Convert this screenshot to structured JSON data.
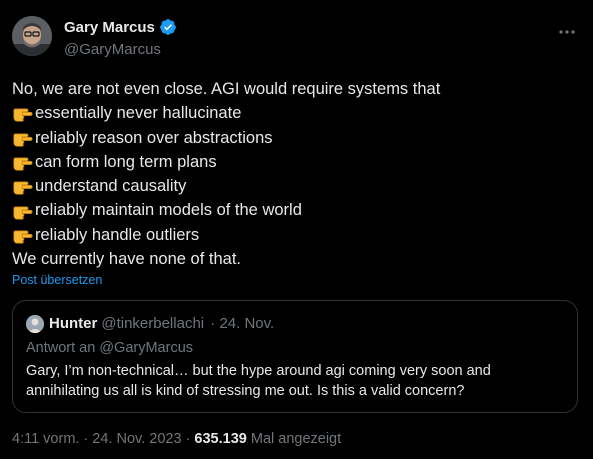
{
  "author": {
    "name": "Gary Marcus",
    "handle": "@GaryMarcus",
    "verified_color": "#1d9bf0"
  },
  "more_icon": "more-horizontal-icon",
  "tweet": {
    "intro": "No, we are not even close. AGI would require systems that",
    "bullet_icon": "pointing-hand-emoji",
    "bullets": [
      "essentially never hallucinate",
      "reliably reason over abstractions",
      "can form long term plans",
      "understand causality",
      "reliably maintain models of the world",
      "reliably handle outliers"
    ],
    "outro": "We currently have none of that."
  },
  "translate_label": "Post übersetzen",
  "quote": {
    "name": "Hunter",
    "handle": "@tinkerbellachi",
    "date": "· 24. Nov.",
    "reply_to": "Antwort an @GaryMarcus",
    "text": "Gary, I’m non-technical… but the hype around agi coming very soon and annihilating us all is kind of stressing me out. Is this a valid concern?"
  },
  "meta": {
    "time_date": "4:11 vorm. · 24. Nov. 2023 ·",
    "views": "635.139",
    "views_label": "Mal angezeigt"
  },
  "colors": {
    "background": "#000000",
    "text": "#e7e9ea",
    "muted": "#71767b",
    "link": "#1d9bf0",
    "border": "#2f3336"
  }
}
